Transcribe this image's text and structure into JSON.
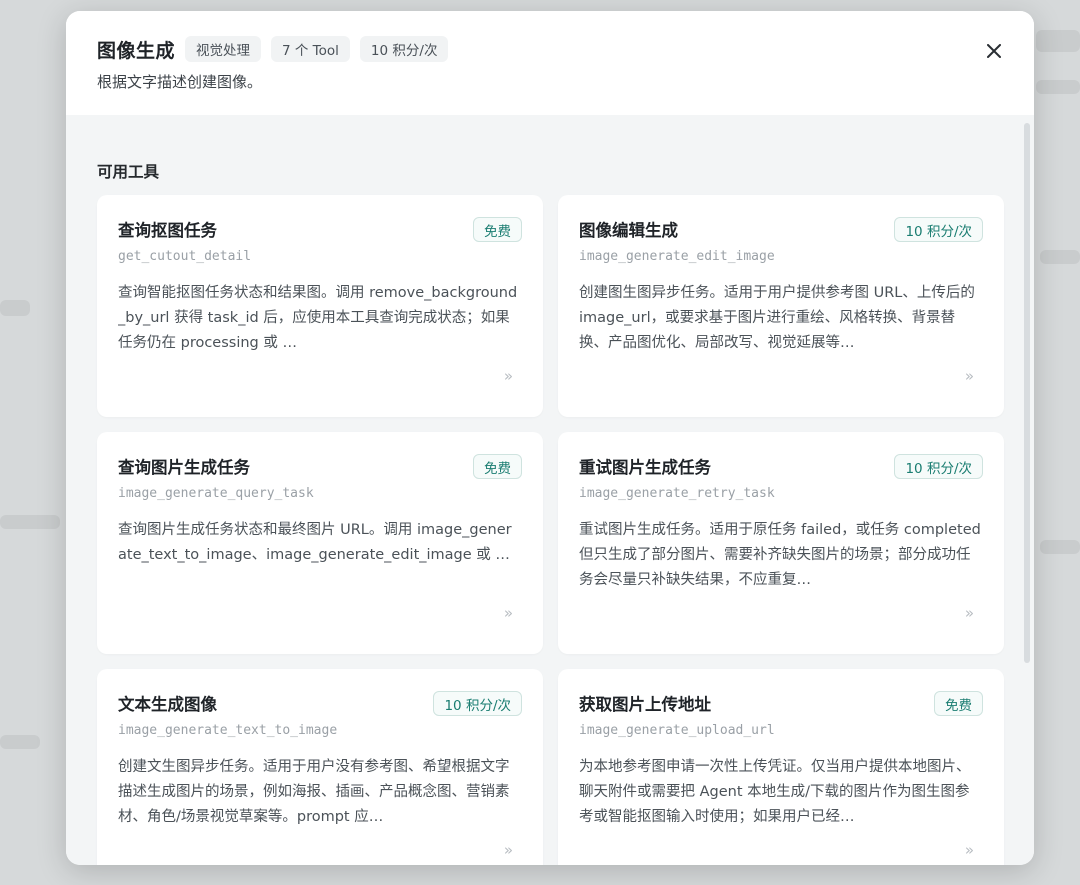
{
  "modal": {
    "title": "图像生成",
    "tags": [
      "视觉处理",
      "7 个 Tool",
      "10 积分/次"
    ],
    "subtitle": "根据文字描述创建图像。",
    "close_icon": "close-icon",
    "section_title": "可用工具"
  },
  "tools": [
    {
      "title": "查询抠图任务",
      "code": "get_cutout_detail",
      "badge": "免费",
      "description": "查询智能抠图任务状态和结果图。调用 remove_background_by_url 获得 task_id 后，应使用本工具查询完成状态；如果任务仍在 processing 或 …",
      "more": "»"
    },
    {
      "title": "图像编辑生成",
      "code": "image_generate_edit_image",
      "badge": "10 积分/次",
      "description": "创建图生图异步任务。适用于用户提供参考图 URL、上传后的 image_url，或要求基于图片进行重绘、风格转换、背景替换、产品图优化、局部改写、视觉延展等…",
      "more": "»"
    },
    {
      "title": "查询图片生成任务",
      "code": "image_generate_query_task",
      "badge": "免费",
      "description": "查询图片生成任务状态和最终图片 URL。调用 image_generate_text_to_image、image_generate_edit_image 或 …",
      "more": "»"
    },
    {
      "title": "重试图片生成任务",
      "code": "image_generate_retry_task",
      "badge": "10 积分/次",
      "description": "重试图片生成任务。适用于原任务 failed，或任务 completed 但只生成了部分图片、需要补齐缺失图片的场景；部分成功任务会尽量只补缺失结果，不应重复…",
      "more": "»"
    },
    {
      "title": "文本生成图像",
      "code": "image_generate_text_to_image",
      "badge": "10 积分/次",
      "description": "创建文生图异步任务。适用于用户没有参考图、希望根据文字描述生成图片的场景，例如海报、插画、产品概念图、营销素材、角色/场景视觉草案等。prompt 应…",
      "more": "»"
    },
    {
      "title": "获取图片上传地址",
      "code": "image_generate_upload_url",
      "badge": "免费",
      "description": "为本地参考图申请一次性上传凭证。仅当用户提供本地图片、聊天附件或需要把 Agent 本地生成/下载的图片作为图生图参考或智能抠图输入时使用；如果用户已经…",
      "more": "»"
    }
  ]
}
